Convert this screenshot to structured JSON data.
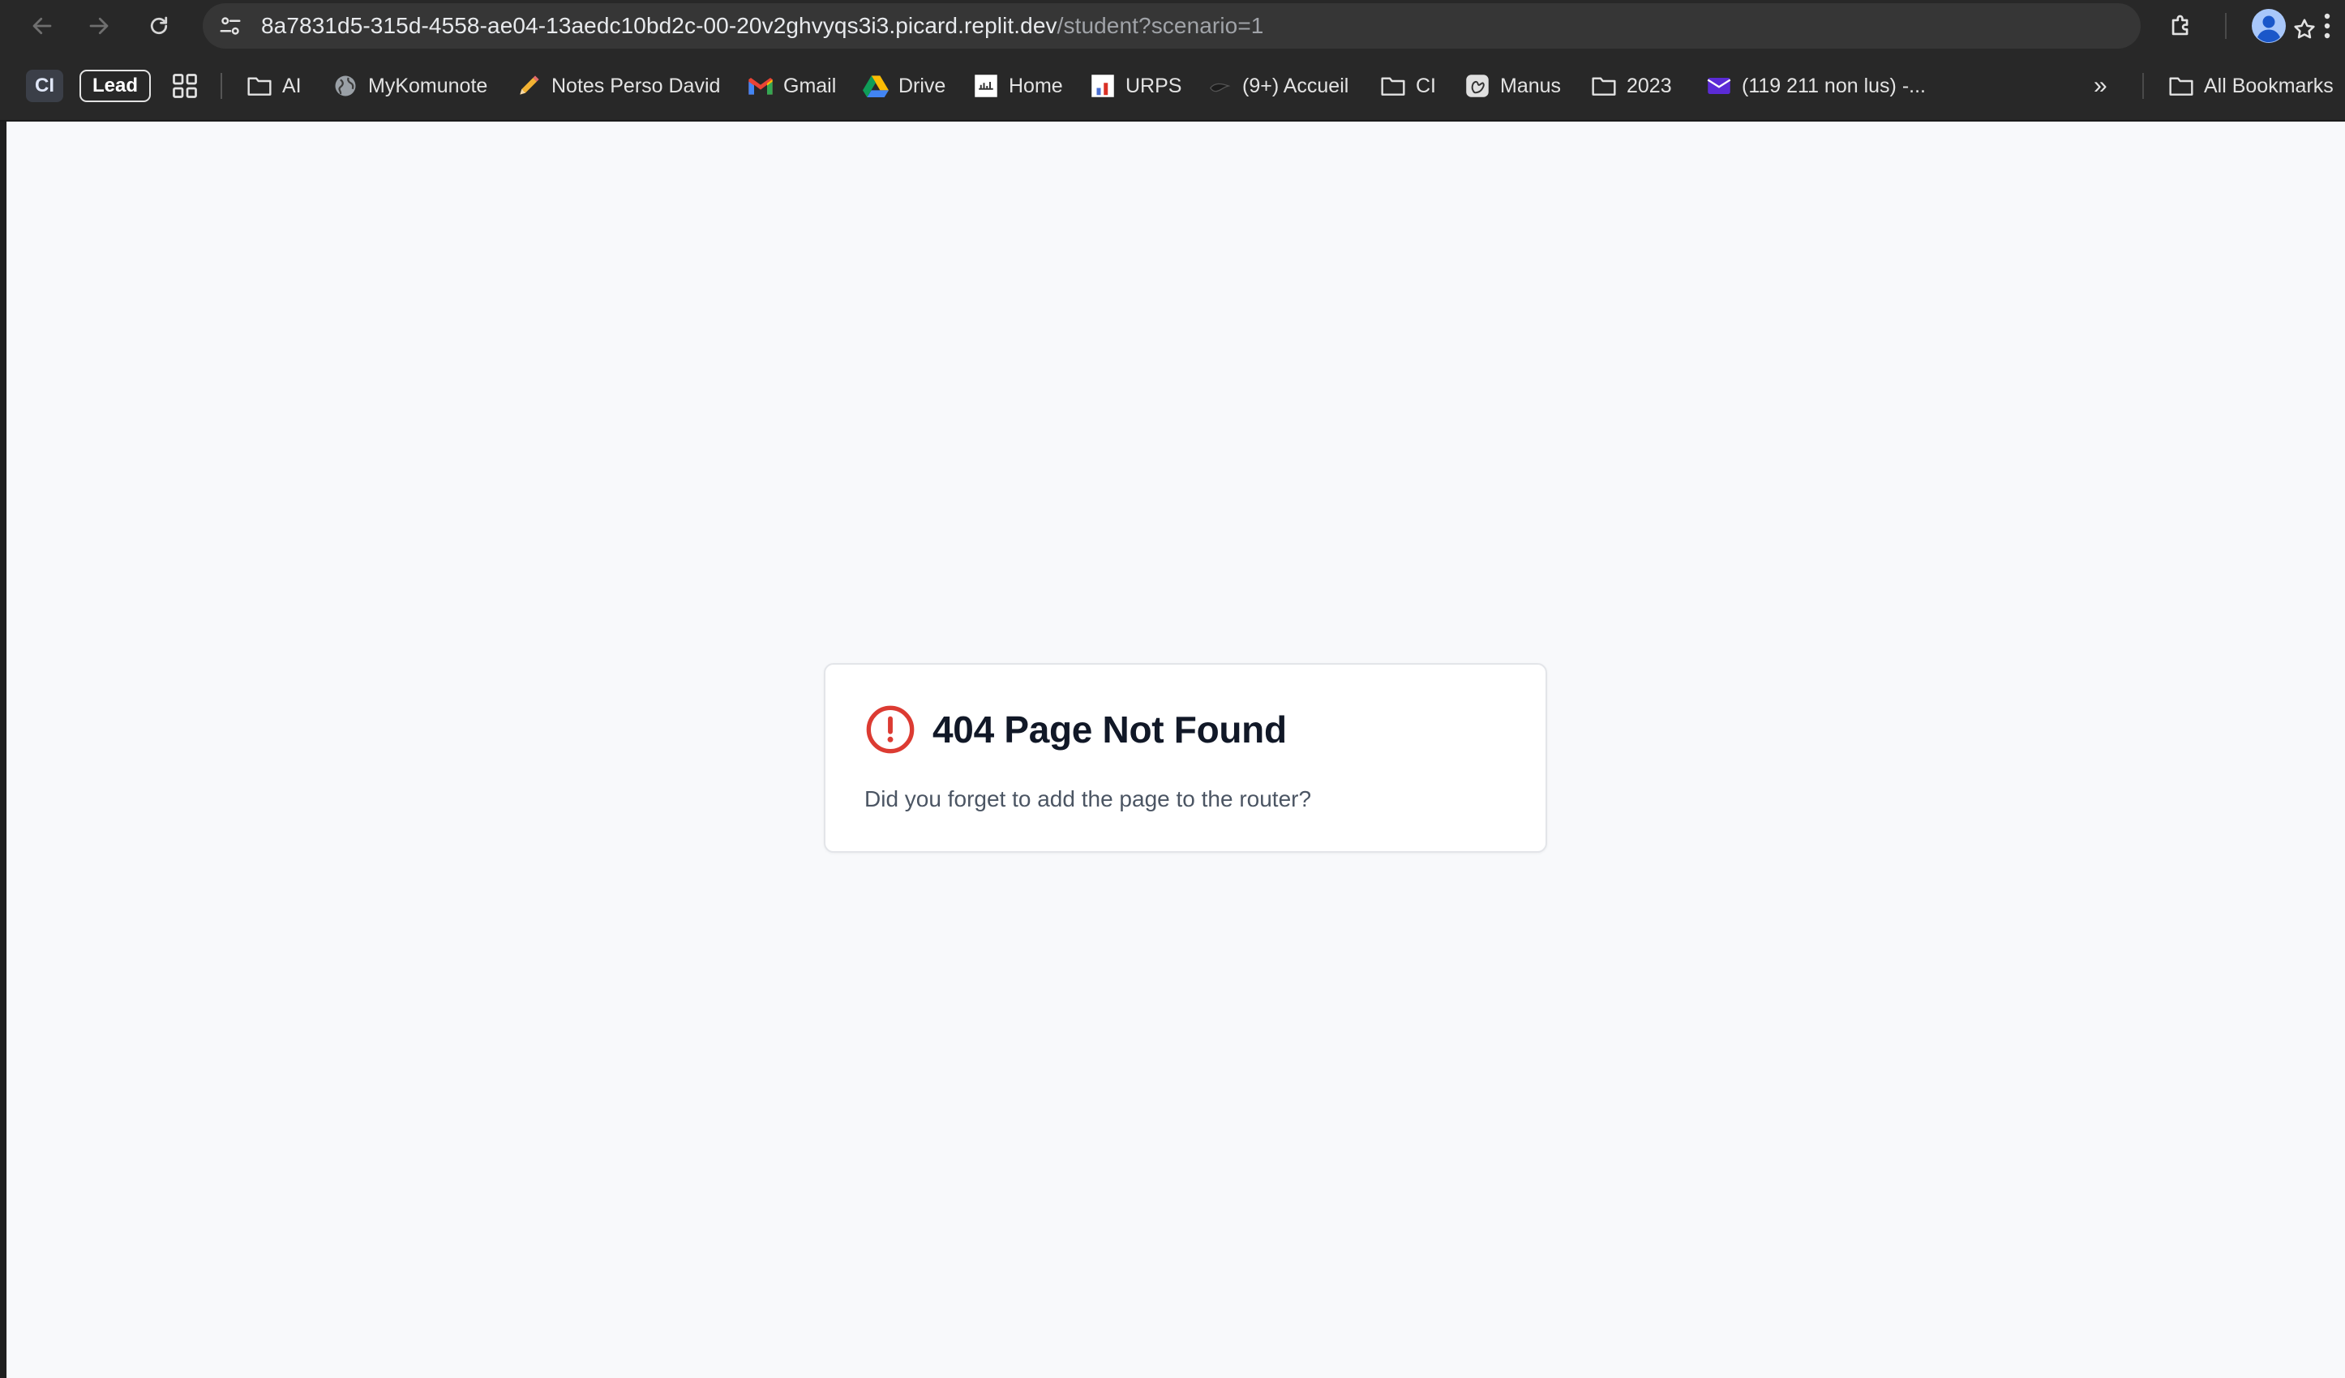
{
  "browser": {
    "url_host": "8a7831d5-315d-4558-ae04-13aedc10bd2c-00-20v2ghvyqs3i3.picard.replit.dev",
    "url_path": "/student?scenario=1",
    "nav_icons": [
      "back-arrow-icon",
      "forward-arrow-icon",
      "reload-icon"
    ],
    "omnibox_icon": "site-info-tune-icon",
    "right_icons": [
      "bookmark-star-icon",
      "extensions-puzzle-icon",
      "profile-avatar-icon",
      "kebab-menu-icon"
    ]
  },
  "bookmarks": {
    "ci_chip": "CI",
    "lead_chip": "Lead",
    "items": [
      {
        "label": "AI",
        "icon": "folder-icon"
      },
      {
        "label": "MyKomunote",
        "icon": "globe-icon"
      },
      {
        "label": "Notes Perso David",
        "icon": "pencil-icon"
      },
      {
        "label": "Gmail",
        "icon": "gmail-icon"
      },
      {
        "label": "Drive",
        "icon": "drive-icon"
      },
      {
        "label": "Home",
        "icon": "home-favicon-icon"
      },
      {
        "label": "URPS",
        "icon": "urps-favicon-icon"
      },
      {
        "label": "(9+) Accueil",
        "icon": "accueil-favicon-icon"
      },
      {
        "label": "CI",
        "icon": "folder-icon"
      },
      {
        "label": "Manus",
        "icon": "manus-icon"
      },
      {
        "label": "2023",
        "icon": "folder-icon"
      },
      {
        "label": "(119 211 non lus) -...",
        "icon": "mail-envelope-icon"
      }
    ],
    "overflow_label": "»",
    "all_bookmarks": "All Bookmarks"
  },
  "page": {
    "title": "404 Page Not Found",
    "message": "Did you forget to add the page to the router?",
    "alert_icon": "alert-circle-icon",
    "colors": {
      "background": "#f8f9fb",
      "alert": "#dc3b32",
      "title": "#111827",
      "message": "#4b5563"
    }
  }
}
